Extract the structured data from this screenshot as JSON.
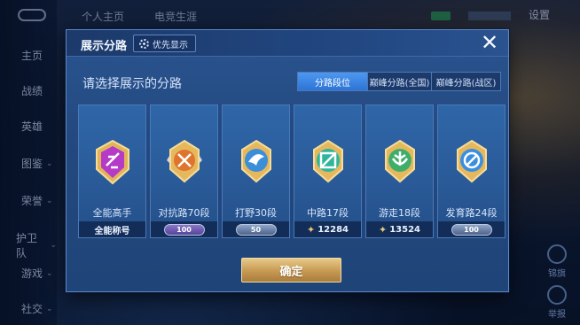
{
  "background": {
    "nav": [
      "主页",
      "战绩",
      "英雄",
      "图鉴",
      "荣誉",
      "护卫队",
      "游戏",
      "社交"
    ],
    "top_tabs": [
      "个人主页",
      "电竞生涯"
    ],
    "settings_label": "设置",
    "side_buttons": [
      "锦旗",
      "举报"
    ]
  },
  "modal": {
    "title": "展示分路",
    "priority_label": "优先显示",
    "close_symbol": "✕",
    "prompt": "请选择展示的分路",
    "tabs": [
      {
        "label": "分路段位",
        "active": true
      },
      {
        "label": "巅峰分路(全国)",
        "active": false
      },
      {
        "label": "巅峰分路(战区)",
        "active": false
      }
    ],
    "cards": [
      {
        "label": "全能高手",
        "bottom_text": "全能称号",
        "type": "text",
        "icon": "all-round-emblem-icon",
        "color": "#b63ac8"
      },
      {
        "label": "对抗路70段",
        "bottom_text": "100",
        "type": "plate",
        "icon": "clash-lane-emblem-icon",
        "color": "#e0742c"
      },
      {
        "label": "打野30段",
        "bottom_text": "50",
        "type": "plate-silver",
        "icon": "jungle-emblem-icon",
        "color": "#3b8ed8"
      },
      {
        "label": "中路17段",
        "bottom_text": "12284",
        "type": "star",
        "icon": "mid-lane-emblem-icon",
        "color": "#2fb59a"
      },
      {
        "label": "游走18段",
        "bottom_text": "13524",
        "type": "star",
        "icon": "roam-emblem-icon",
        "color": "#3fae6a"
      },
      {
        "label": "发育路24段",
        "bottom_text": "100",
        "type": "plate-silver",
        "icon": "farm-lane-emblem-icon",
        "color": "#3a8fe0"
      }
    ],
    "confirm_label": "确定"
  }
}
